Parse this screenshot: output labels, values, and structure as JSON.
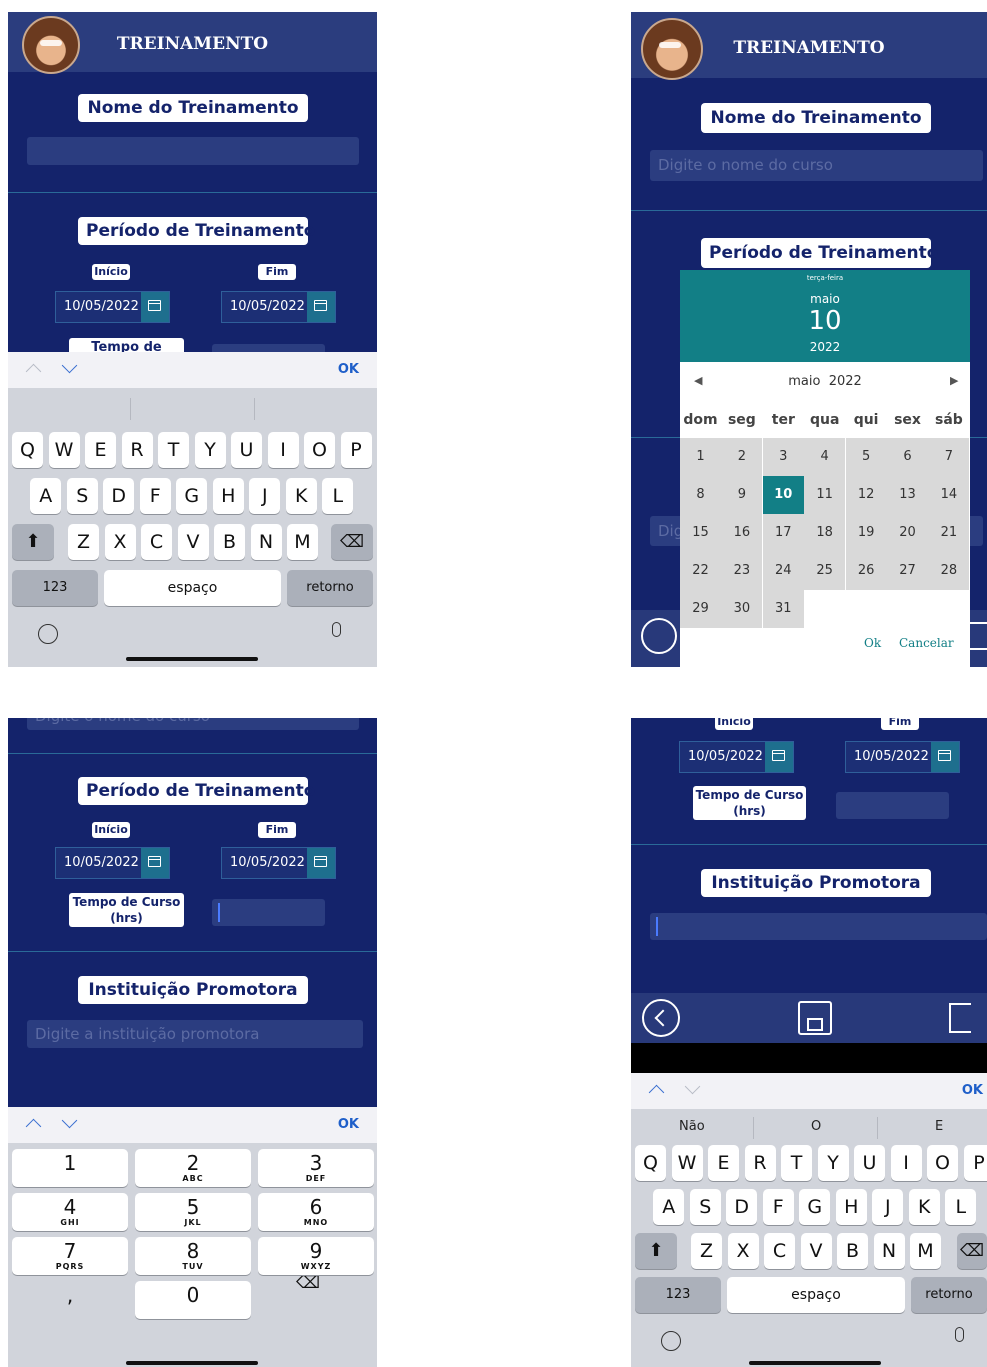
{
  "screen1": {
    "header_title": "TREINAMENTO",
    "nome_label": "Nome do Treinamento",
    "nome_value": "",
    "periodo_label": "Período de Treinamento",
    "inicio_label": "Início",
    "fim_label": "Fim",
    "inicio_date": "10/05/2022",
    "fim_date": "10/05/2022",
    "tempo_label_partial": "Tempo de",
    "keyboard": {
      "ok": "OK",
      "row1": [
        "Q",
        "W",
        "E",
        "R",
        "T",
        "Y",
        "U",
        "I",
        "O",
        "P"
      ],
      "row2": [
        "A",
        "S",
        "D",
        "F",
        "G",
        "H",
        "J",
        "K",
        "L"
      ],
      "row3": [
        "Z",
        "X",
        "C",
        "V",
        "B",
        "N",
        "M"
      ],
      "num_key": "123",
      "space": "espaço",
      "return": "retorno"
    }
  },
  "screen2": {
    "header_title": "TREINAMENTO",
    "nome_label": "Nome do Treinamento",
    "nome_placeholder": "Digite o nome do curso",
    "periodo_label": "Período de Treinamento",
    "hidden_field_fragment": "Dig",
    "datepicker": {
      "weekday": "terça-feira",
      "month": "maio",
      "day": "10",
      "year": "2022",
      "nav_month": "maio",
      "nav_year": "2022",
      "weekdays": [
        "dom",
        "seg",
        "ter",
        "qua",
        "qui",
        "sex",
        "sáb"
      ],
      "days": [
        "1",
        "2",
        "3",
        "4",
        "5",
        "6",
        "7",
        "8",
        "9",
        "10",
        "11",
        "12",
        "13",
        "14",
        "15",
        "16",
        "17",
        "18",
        "19",
        "20",
        "21",
        "22",
        "23",
        "24",
        "25",
        "26",
        "27",
        "28",
        "29",
        "30",
        "31"
      ],
      "selected_day": "10",
      "ok_label": "Ok",
      "cancel_label": "Cancelar"
    }
  },
  "screen3": {
    "top_fragment": "Digite o nome do curso",
    "periodo_label": "Período de Treinamento",
    "inicio_label": "Início",
    "fim_label": "Fim",
    "inicio_date": "10/05/2022",
    "fim_date": "10/05/2022",
    "tempo_label": "Tempo de Curso (hrs)",
    "instituicao_label": "Instituição Promotora",
    "instituicao_placeholder": "Digite a instituição promotora",
    "numpad": {
      "ok": "OK",
      "keys": [
        {
          "n": "1",
          "l": ""
        },
        {
          "n": "2",
          "l": "ABC"
        },
        {
          "n": "3",
          "l": "DEF"
        },
        {
          "n": "4",
          "l": "GHI"
        },
        {
          "n": "5",
          "l": "JKL"
        },
        {
          "n": "6",
          "l": "MNO"
        },
        {
          "n": "7",
          "l": "PQRS"
        },
        {
          "n": "8",
          "l": "TUV"
        },
        {
          "n": "9",
          "l": "WXYZ"
        },
        {
          "n": ",",
          "l": ""
        },
        {
          "n": "0",
          "l": ""
        }
      ]
    }
  },
  "screen4": {
    "inicio_label": "Início",
    "fim_label": "Fim",
    "inicio_date": "10/05/2022",
    "fim_date": "10/05/2022",
    "tempo_label": "Tempo de Curso (hrs)",
    "instituicao_label": "Instituição Promotora",
    "keyboard": {
      "ok": "OK",
      "suggestions": [
        "Não",
        "O",
        "E"
      ],
      "row1": [
        "Q",
        "W",
        "E",
        "R",
        "T",
        "Y",
        "U",
        "I",
        "O",
        "P"
      ],
      "row2": [
        "A",
        "S",
        "D",
        "F",
        "G",
        "H",
        "J",
        "K",
        "L"
      ],
      "row3": [
        "Z",
        "X",
        "C",
        "V",
        "B",
        "N",
        "M"
      ],
      "num_key": "123",
      "space": "espaço",
      "return": "retorno"
    }
  }
}
